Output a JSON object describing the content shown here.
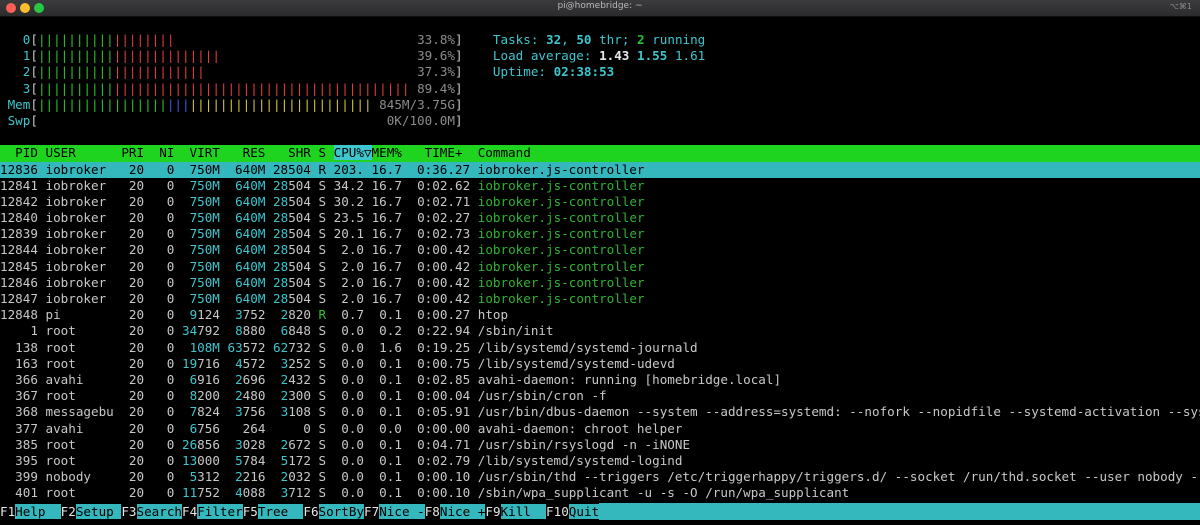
{
  "window": {
    "title": "pi@homebridge: ~",
    "shortcut": "⌥⌘1"
  },
  "meters": {
    "cpus": [
      {
        "label": "0",
        "value": "33.8%"
      },
      {
        "label": "1",
        "value": "39.6%"
      },
      {
        "label": "2",
        "value": "37.3%"
      },
      {
        "label": "3",
        "value": "89.4%"
      }
    ],
    "mem": {
      "label": "Mem",
      "value": "845M/3.75G"
    },
    "swp": {
      "label": "Swp",
      "value": "0K/100.0M"
    }
  },
  "summary": {
    "tasks_label": "Tasks:",
    "tasks": "32",
    "thr": "50",
    "thr_label": "thr;",
    "running": "2",
    "running_label": "running",
    "load_label": "Load average:",
    "load1": "1.43",
    "load5": "1.55",
    "load15": "1.61",
    "uptime_label": "Uptime:",
    "uptime": "02:38:53"
  },
  "columns": [
    "PID",
    "USER",
    "PRI",
    "NI",
    "VIRT",
    "RES",
    "SHR",
    "S",
    "CPU%",
    "MEM%",
    "TIME+",
    "Command"
  ],
  "sort_indicator": "▽",
  "processes": [
    {
      "pid": "12836",
      "user": "iobroker",
      "pri": "20",
      "ni": "0",
      "virt": "750M",
      "res": "640M",
      "shr": "28504",
      "s": "R",
      "cpu": "203.",
      "mem": "16.7",
      "time": "0:36.27",
      "cmd": "iobroker.js-controller",
      "selected": true
    },
    {
      "pid": "12841",
      "user": "iobroker",
      "pri": "20",
      "ni": "0",
      "virt": "750M",
      "res": "640M",
      "shr": "28504",
      "s": "S",
      "cpu": "34.2",
      "mem": "16.7",
      "time": "0:02.62",
      "cmd": "iobroker.js-controller",
      "thread": true
    },
    {
      "pid": "12842",
      "user": "iobroker",
      "pri": "20",
      "ni": "0",
      "virt": "750M",
      "res": "640M",
      "shr": "28504",
      "s": "S",
      "cpu": "30.2",
      "mem": "16.7",
      "time": "0:02.71",
      "cmd": "iobroker.js-controller",
      "thread": true
    },
    {
      "pid": "12840",
      "user": "iobroker",
      "pri": "20",
      "ni": "0",
      "virt": "750M",
      "res": "640M",
      "shr": "28504",
      "s": "S",
      "cpu": "23.5",
      "mem": "16.7",
      "time": "0:02.27",
      "cmd": "iobroker.js-controller",
      "thread": true
    },
    {
      "pid": "12839",
      "user": "iobroker",
      "pri": "20",
      "ni": "0",
      "virt": "750M",
      "res": "640M",
      "shr": "28504",
      "s": "S",
      "cpu": "20.1",
      "mem": "16.7",
      "time": "0:02.73",
      "cmd": "iobroker.js-controller",
      "thread": true
    },
    {
      "pid": "12844",
      "user": "iobroker",
      "pri": "20",
      "ni": "0",
      "virt": "750M",
      "res": "640M",
      "shr": "28504",
      "s": "S",
      "cpu": "2.0",
      "mem": "16.7",
      "time": "0:00.42",
      "cmd": "iobroker.js-controller",
      "thread": true
    },
    {
      "pid": "12845",
      "user": "iobroker",
      "pri": "20",
      "ni": "0",
      "virt": "750M",
      "res": "640M",
      "shr": "28504",
      "s": "S",
      "cpu": "2.0",
      "mem": "16.7",
      "time": "0:00.42",
      "cmd": "iobroker.js-controller",
      "thread": true
    },
    {
      "pid": "12846",
      "user": "iobroker",
      "pri": "20",
      "ni": "0",
      "virt": "750M",
      "res": "640M",
      "shr": "28504",
      "s": "S",
      "cpu": "2.0",
      "mem": "16.7",
      "time": "0:00.42",
      "cmd": "iobroker.js-controller",
      "thread": true
    },
    {
      "pid": "12847",
      "user": "iobroker",
      "pri": "20",
      "ni": "0",
      "virt": "750M",
      "res": "640M",
      "shr": "28504",
      "s": "S",
      "cpu": "2.0",
      "mem": "16.7",
      "time": "0:00.42",
      "cmd": "iobroker.js-controller",
      "thread": true
    },
    {
      "pid": "12848",
      "user": "pi",
      "pri": "20",
      "ni": "0",
      "virt": "9124",
      "res": "3752",
      "shr": "2820",
      "s": "R",
      "cpu": "0.7",
      "mem": "0.1",
      "time": "0:00.27",
      "cmd": "htop"
    },
    {
      "pid": "1",
      "user": "root",
      "pri": "20",
      "ni": "0",
      "virt": "34792",
      "res": "8880",
      "shr": "6848",
      "s": "S",
      "cpu": "0.0",
      "mem": "0.2",
      "time": "0:22.94",
      "cmd": "/sbin/init"
    },
    {
      "pid": "138",
      "user": "root",
      "pri": "20",
      "ni": "0",
      "virt": "108M",
      "res": "63572",
      "shr": "62732",
      "s": "S",
      "cpu": "0.0",
      "mem": "1.6",
      "time": "0:19.25",
      "cmd": "/lib/systemd/systemd-journald"
    },
    {
      "pid": "163",
      "user": "root",
      "pri": "20",
      "ni": "0",
      "virt": "19716",
      "res": "4572",
      "shr": "3252",
      "s": "S",
      "cpu": "0.0",
      "mem": "0.1",
      "time": "0:00.75",
      "cmd": "/lib/systemd/systemd-udevd"
    },
    {
      "pid": "366",
      "user": "avahi",
      "pri": "20",
      "ni": "0",
      "virt": "6916",
      "res": "2696",
      "shr": "2432",
      "s": "S",
      "cpu": "0.0",
      "mem": "0.1",
      "time": "0:02.85",
      "cmd": "avahi-daemon: running [homebridge.local]"
    },
    {
      "pid": "367",
      "user": "root",
      "pri": "20",
      "ni": "0",
      "virt": "8200",
      "res": "2480",
      "shr": "2300",
      "s": "S",
      "cpu": "0.0",
      "mem": "0.1",
      "time": "0:00.04",
      "cmd": "/usr/sbin/cron -f"
    },
    {
      "pid": "368",
      "user": "messagebu",
      "pri": "20",
      "ni": "0",
      "virt": "7824",
      "res": "3756",
      "shr": "3108",
      "s": "S",
      "cpu": "0.0",
      "mem": "0.1",
      "time": "0:05.91",
      "cmd": "/usr/bin/dbus-daemon --system --address=systemd: --nofork --nopidfile --systemd-activation --syslog-"
    },
    {
      "pid": "377",
      "user": "avahi",
      "pri": "20",
      "ni": "0",
      "virt": "6756",
      "res": "264",
      "shr": "0",
      "s": "S",
      "cpu": "0.0",
      "mem": "0.0",
      "time": "0:00.00",
      "cmd": "avahi-daemon: chroot helper"
    },
    {
      "pid": "385",
      "user": "root",
      "pri": "20",
      "ni": "0",
      "virt": "26856",
      "res": "3028",
      "shr": "2672",
      "s": "S",
      "cpu": "0.0",
      "mem": "0.1",
      "time": "0:04.71",
      "cmd": "/usr/sbin/rsyslogd -n -iNONE"
    },
    {
      "pid": "395",
      "user": "root",
      "pri": "20",
      "ni": "0",
      "virt": "13000",
      "res": "5784",
      "shr": "5172",
      "s": "S",
      "cpu": "0.0",
      "mem": "0.1",
      "time": "0:02.79",
      "cmd": "/lib/systemd/systemd-logind"
    },
    {
      "pid": "399",
      "user": "nobody",
      "pri": "20",
      "ni": "0",
      "virt": "5312",
      "res": "2216",
      "shr": "2032",
      "s": "S",
      "cpu": "0.0",
      "mem": "0.1",
      "time": "0:00.10",
      "cmd": "/usr/sbin/thd --triggers /etc/triggerhappy/triggers.d/ --socket /run/thd.socket --user nobody --devi"
    },
    {
      "pid": "401",
      "user": "root",
      "pri": "20",
      "ni": "0",
      "virt": "11752",
      "res": "4088",
      "shr": "3712",
      "s": "S",
      "cpu": "0.0",
      "mem": "0.1",
      "time": "0:00.10",
      "cmd": "/sbin/wpa_supplicant -u -s -O /run/wpa_supplicant"
    }
  ],
  "footer": [
    {
      "key": "F1",
      "label": "Help  "
    },
    {
      "key": "F2",
      "label": "Setup "
    },
    {
      "key": "F3",
      "label": "Search"
    },
    {
      "key": "F4",
      "label": "Filter"
    },
    {
      "key": "F5",
      "label": "Tree  "
    },
    {
      "key": "F6",
      "label": "SortBy"
    },
    {
      "key": "F7",
      "label": "Nice -"
    },
    {
      "key": "F8",
      "label": "Nice +"
    },
    {
      "key": "F9",
      "label": "Kill  "
    },
    {
      "key": "F10",
      "label": "Quit"
    }
  ],
  "colors": {
    "header_bg": "#1fd41f",
    "selected_bg": "#34b8bd",
    "cyan": "#3ec6ce",
    "green": "#29c329"
  }
}
